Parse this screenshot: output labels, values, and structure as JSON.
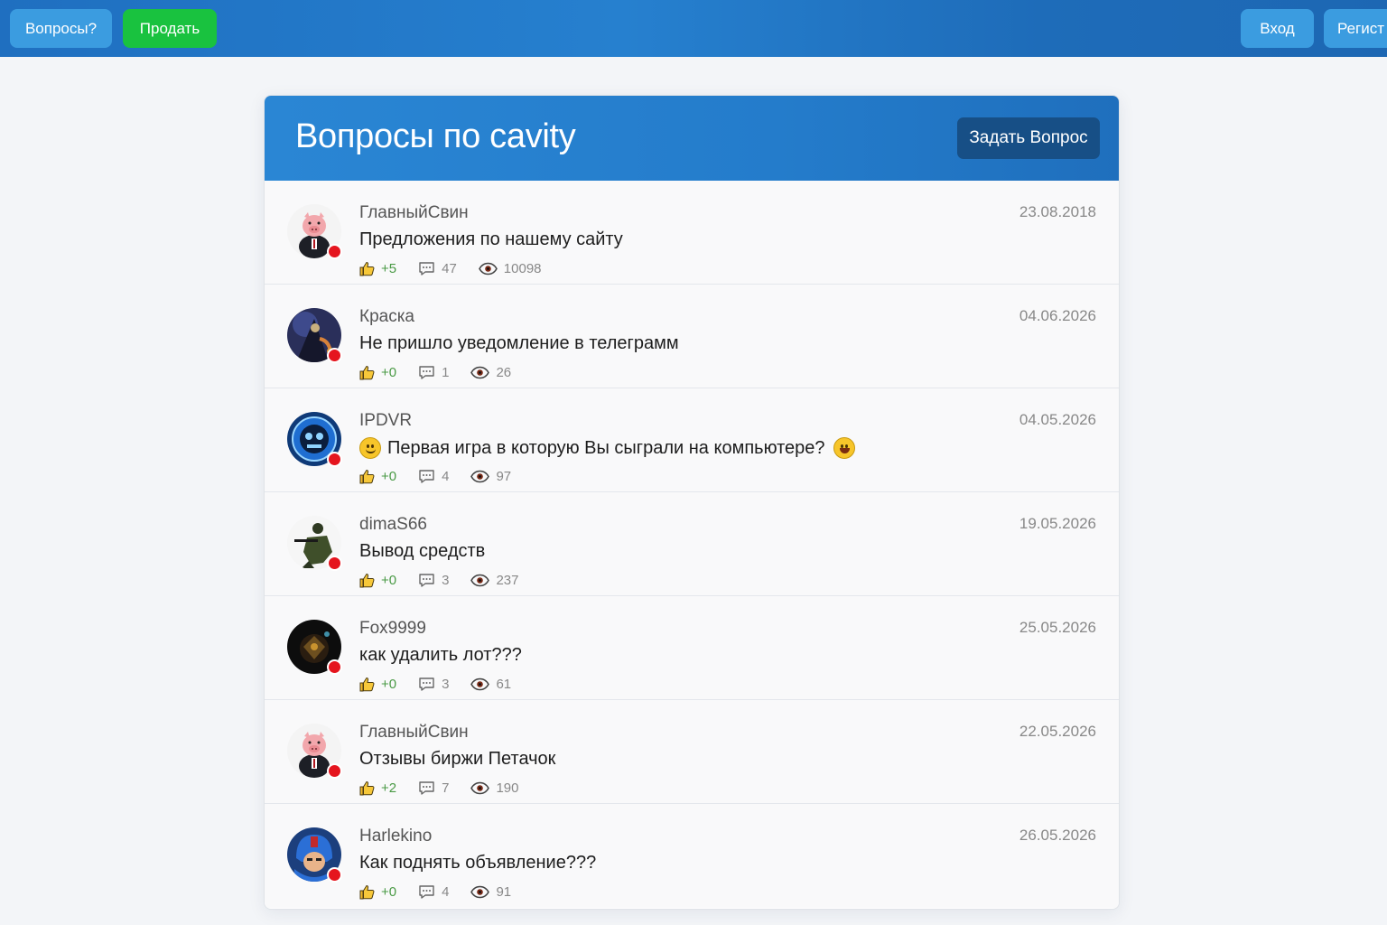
{
  "topbar": {
    "questions_label": "Вопросы?",
    "sell_label": "Продать",
    "login_label": "Вход",
    "register_label": "Регист"
  },
  "page": {
    "title": "Вопросы по cavity",
    "ask_label": "Задать Вопрос"
  },
  "colors": {
    "brand_blue": "#2680cf",
    "sell_green": "#19c23f",
    "online_dot": "#e5151e",
    "like_green": "#4a9a45"
  },
  "questions": [
    {
      "author": "ГлавныйСвин",
      "date": "23.08.2018",
      "title": "Предложения по нашему сайту",
      "likes": "+5",
      "comments": "47",
      "views": "10098",
      "avatar": "pig-avatar"
    },
    {
      "author": "Краска",
      "date": "04.06.2026",
      "title": "Не пришло уведомление в телеграмм",
      "likes": "+0",
      "comments": "1",
      "views": "26",
      "avatar": "dark-character-avatar"
    },
    {
      "author": "IPDVR",
      "date": "04.05.2026",
      "title": "Первая игра в которую Вы сыграли на компьютере?",
      "likes": "+0",
      "comments": "4",
      "views": "97",
      "avatar": "blue-robot-avatar"
    },
    {
      "author": "dimaS66",
      "date": "19.05.2026",
      "title": "Вывод средств",
      "likes": "+0",
      "comments": "3",
      "views": "237",
      "avatar": "soldier-avatar"
    },
    {
      "author": "Fox9999",
      "date": "25.05.2026",
      "title": "как удалить лот???",
      "likes": "+0",
      "comments": "3",
      "views": "61",
      "avatar": "dark-game-avatar"
    },
    {
      "author": "ГлавныйСвин",
      "date": "22.05.2026",
      "title": "Отзывы биржи Петачок",
      "likes": "+2",
      "comments": "7",
      "views": "190",
      "avatar": "pig-avatar"
    },
    {
      "author": "Harlekino",
      "date": "26.05.2026",
      "title": "Как поднять объявление???",
      "likes": "+0",
      "comments": "4",
      "views": "91",
      "avatar": "megaman-avatar"
    }
  ]
}
